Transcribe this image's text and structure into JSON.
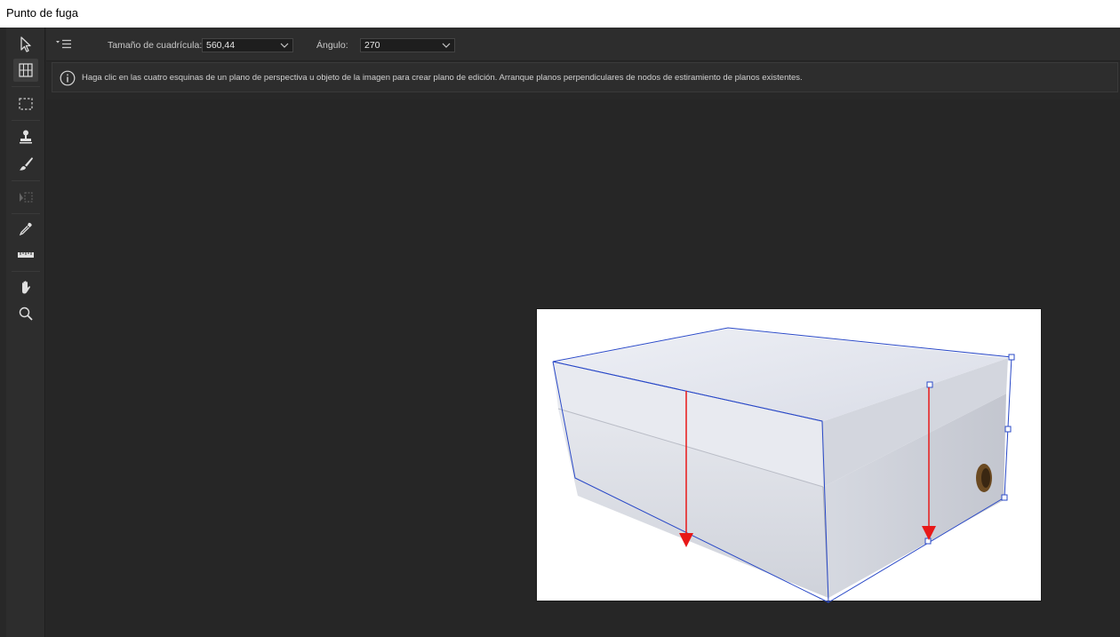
{
  "window": {
    "title": "Punto de fuga"
  },
  "options": {
    "grid_size_label": "Tamaño de cuadrícula:",
    "grid_size_value": "560,44",
    "angle_label": "Ángulo:",
    "angle_value": "270"
  },
  "info": {
    "message": "Haga clic en las cuatro esquinas de un plano de perspectiva u objeto de la imagen para crear plano de edición. Arranque planos perpendiculares de nodos de estiramiento de planos existentes."
  },
  "tools": [
    {
      "name": "edit-plane-tool",
      "icon": "arrow-cursor-icon",
      "active": false
    },
    {
      "name": "create-plane-tool",
      "icon": "grid-plane-icon",
      "active": true
    },
    {
      "name": "marquee-tool",
      "icon": "dashed-rectangle-icon",
      "active": false
    },
    {
      "name": "stamp-tool",
      "icon": "stamp-icon",
      "active": false
    },
    {
      "name": "brush-tool",
      "icon": "brush-icon",
      "active": false
    },
    {
      "name": "transform-tool",
      "icon": "transform-icon",
      "active": false,
      "disabled": true
    },
    {
      "name": "eyedropper-tool",
      "icon": "eyedropper-icon",
      "active": false
    },
    {
      "name": "measure-tool",
      "icon": "ruler-icon",
      "active": false
    },
    {
      "name": "hand-tool",
      "icon": "hand-icon",
      "active": false
    },
    {
      "name": "zoom-tool",
      "icon": "magnifier-icon",
      "active": false
    }
  ],
  "colors": {
    "plane_outline": "#2a49c7",
    "arrow": "#e81818",
    "panel": "#2d2d2d",
    "canvas": "#262626"
  }
}
